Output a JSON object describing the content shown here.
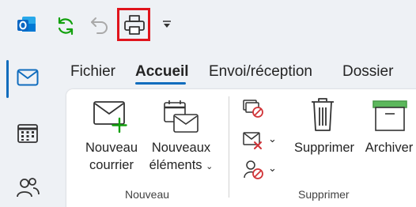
{
  "quick_access": {
    "icons": [
      "outlook-logo-icon",
      "sync-icon",
      "undo-icon",
      "print-icon",
      "customize-dropdown-icon"
    ],
    "highlight_color": "#e0141c"
  },
  "nav_rail": {
    "items": [
      "mail-icon",
      "calendar-icon",
      "people-icon"
    ],
    "active": "mail"
  },
  "tabs": [
    {
      "label": "Fichier"
    },
    {
      "label": "Accueil"
    },
    {
      "label": "Envoi/réception"
    },
    {
      "label": "Dossier"
    }
  ],
  "active_tab": "Accueil",
  "ribbon": {
    "new_group": {
      "label": "Nouveau",
      "new_mail": {
        "line1": "Nouveau",
        "line2": "courrier"
      },
      "new_items": {
        "line1": "Nouveaux",
        "line2": "éléments"
      }
    },
    "delete_group": {
      "label": "Supprimer",
      "delete_label": "Supprimer",
      "archive_label": "Archiver"
    }
  },
  "colors": {
    "accent": "#0f6cbd",
    "outlook_blue": "#0a66c2",
    "sync_green": "#13a10e",
    "delete_red": "#d13438",
    "archive_green": "#5cb85c"
  }
}
